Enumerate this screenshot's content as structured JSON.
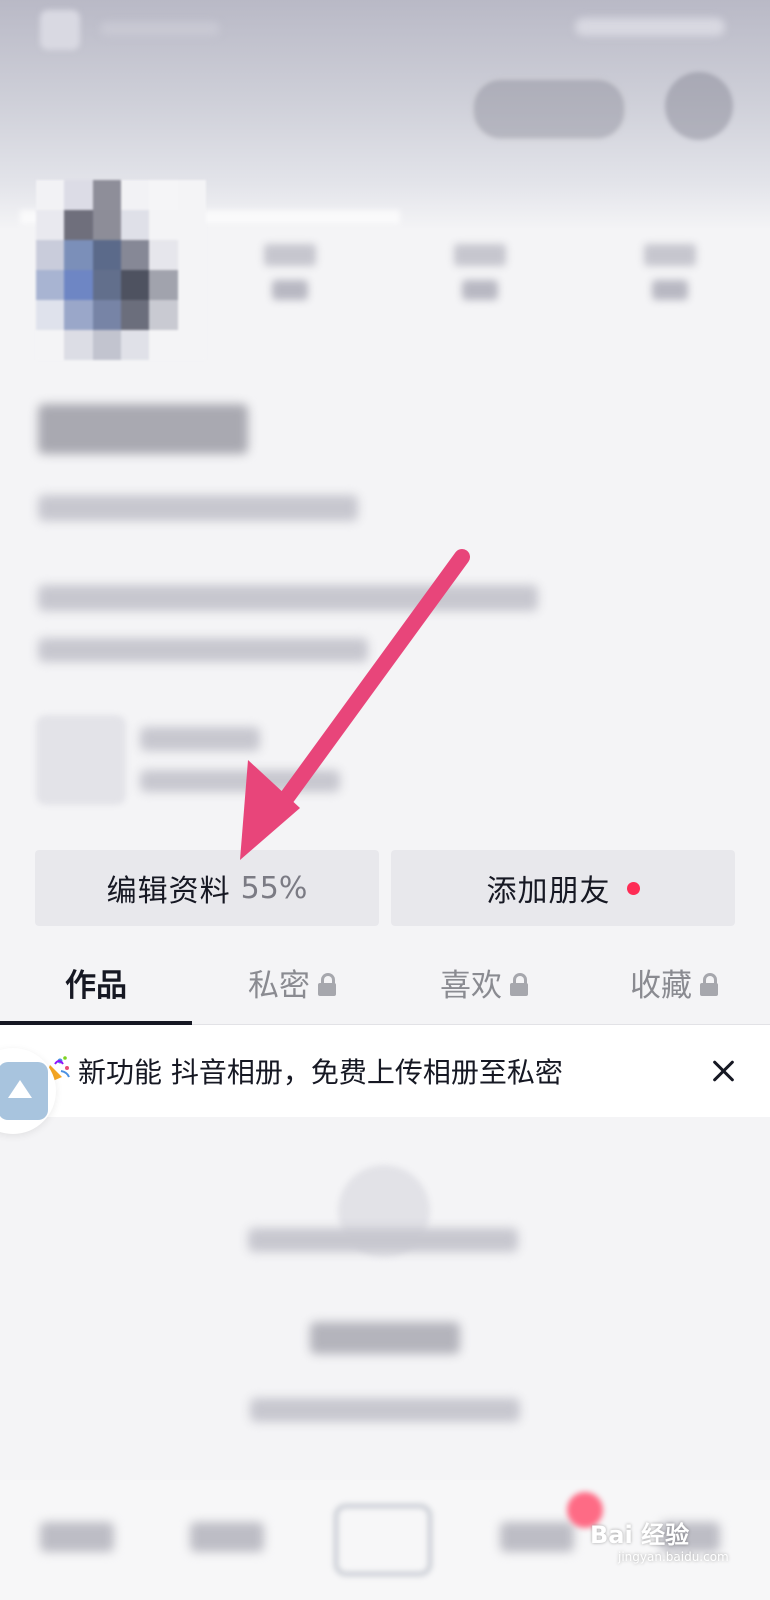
{
  "actions": {
    "edit_profile_label": "编辑资料",
    "edit_profile_progress": "55%",
    "add_friends_label": "添加朋友"
  },
  "tabs": [
    {
      "label": "作品",
      "active": true,
      "locked": false
    },
    {
      "label": "私密",
      "active": false,
      "locked": true
    },
    {
      "label": "喜欢",
      "active": false,
      "locked": true
    },
    {
      "label": "收藏",
      "active": false,
      "locked": true
    }
  ],
  "banner": {
    "text": "新功能 抖音相册，免费上传相册至私密"
  },
  "watermark": {
    "brand": "Bai 经验",
    "url": "jingyan.baidu.com"
  },
  "colors": {
    "accent": "#fe2c55",
    "annotation_arrow": "#e8457a",
    "button_bg": "#e8e8ec",
    "text_primary": "#161823",
    "text_secondary": "#8a8b91"
  },
  "icons": {
    "tab_lock": "lock-icon",
    "banner_leading": "party-popper-icon",
    "banner_close": "close-icon",
    "album_float": "album-icon"
  }
}
